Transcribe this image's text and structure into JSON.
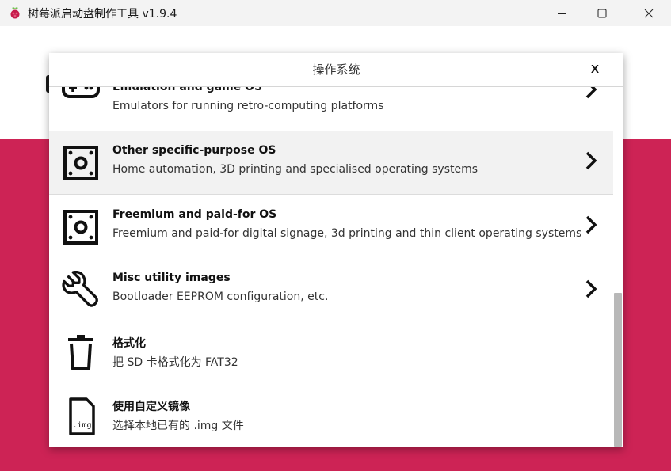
{
  "window": {
    "title": "树莓派启动盘制作工具 v1.9.4",
    "controls": {
      "minimize": "minimize-icon",
      "maximize": "maximize-icon",
      "close": "close-icon"
    }
  },
  "dialog": {
    "title": "操作系统",
    "close_label": "X",
    "items": [
      {
        "name": "Emulation and game OS",
        "description": "Emulators for running retro-computing platforms",
        "icon": "gamepad-icon",
        "has_chevron": true
      },
      {
        "name": "Other specific-purpose OS",
        "description": "Home automation, 3D printing and specialised operating systems",
        "icon": "chip-board-icon",
        "has_chevron": true
      },
      {
        "name": "Freemium and paid-for OS",
        "description": "Freemium and paid-for digital signage, 3d printing and thin client operating systems",
        "icon": "chip-board-icon",
        "has_chevron": true
      },
      {
        "name": "Misc utility images",
        "description": "Bootloader EEPROM configuration, etc.",
        "icon": "wrench-icon",
        "has_chevron": true
      },
      {
        "name": "格式化",
        "description": "把 SD 卡格式化为 FAT32",
        "icon": "trash-icon",
        "has_chevron": false
      },
      {
        "name": "使用自定义镜像",
        "description": "选择本地已有的 .img 文件",
        "icon": "img-file-icon",
        "has_chevron": false
      }
    ]
  },
  "colors": {
    "accent": "#cd2355",
    "hover_row": "#f2f2f2",
    "scroll_thumb": "#b8b8b8"
  }
}
